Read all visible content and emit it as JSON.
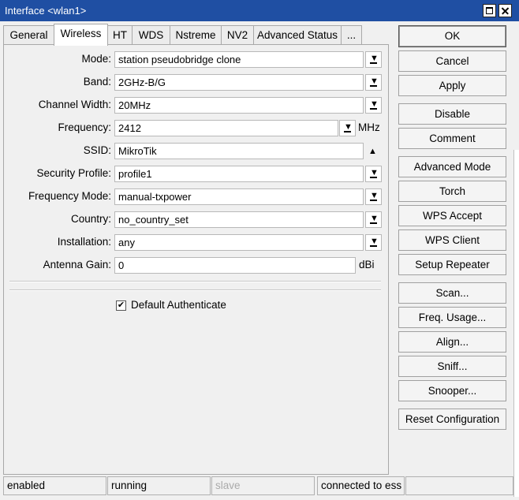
{
  "window": {
    "title": "Interface <wlan1>"
  },
  "tabs": [
    {
      "label": "General"
    },
    {
      "label": "Wireless"
    },
    {
      "label": "HT"
    },
    {
      "label": "WDS"
    },
    {
      "label": "Nstreme"
    },
    {
      "label": "NV2"
    },
    {
      "label": "Advanced Status"
    },
    {
      "label": "..."
    }
  ],
  "form": {
    "mode": {
      "label": "Mode:",
      "value": "station pseudobridge clone"
    },
    "band": {
      "label": "Band:",
      "value": "2GHz-B/G"
    },
    "channel_width": {
      "label": "Channel Width:",
      "value": "20MHz"
    },
    "frequency": {
      "label": "Frequency:",
      "value": "2412",
      "unit": "MHz"
    },
    "ssid": {
      "label": "SSID:",
      "value": "MikroTik"
    },
    "security_profile": {
      "label": "Security Profile:",
      "value": "profile1"
    },
    "frequency_mode": {
      "label": "Frequency Mode:",
      "value": "manual-txpower"
    },
    "country": {
      "label": "Country:",
      "value": "no_country_set"
    },
    "installation": {
      "label": "Installation:",
      "value": "any"
    },
    "antenna_gain": {
      "label": "Antenna Gain:",
      "value": "0",
      "unit": "dBi"
    },
    "default_authenticate": {
      "label": "Default Authenticate",
      "checked": true
    }
  },
  "buttons": {
    "ok": "OK",
    "cancel": "Cancel",
    "apply": "Apply",
    "disable": "Disable",
    "comment": "Comment",
    "advanced_mode": "Advanced Mode",
    "torch": "Torch",
    "wps_accept": "WPS Accept",
    "wps_client": "WPS Client",
    "setup_repeater": "Setup Repeater",
    "scan": "Scan...",
    "freq_usage": "Freq. Usage...",
    "align": "Align...",
    "sniff": "Sniff...",
    "snooper": "Snooper...",
    "reset_configuration": "Reset Configuration"
  },
  "statusbar": {
    "enabled": "enabled",
    "running": "running",
    "slave": "slave",
    "connection": "connected to ess"
  }
}
